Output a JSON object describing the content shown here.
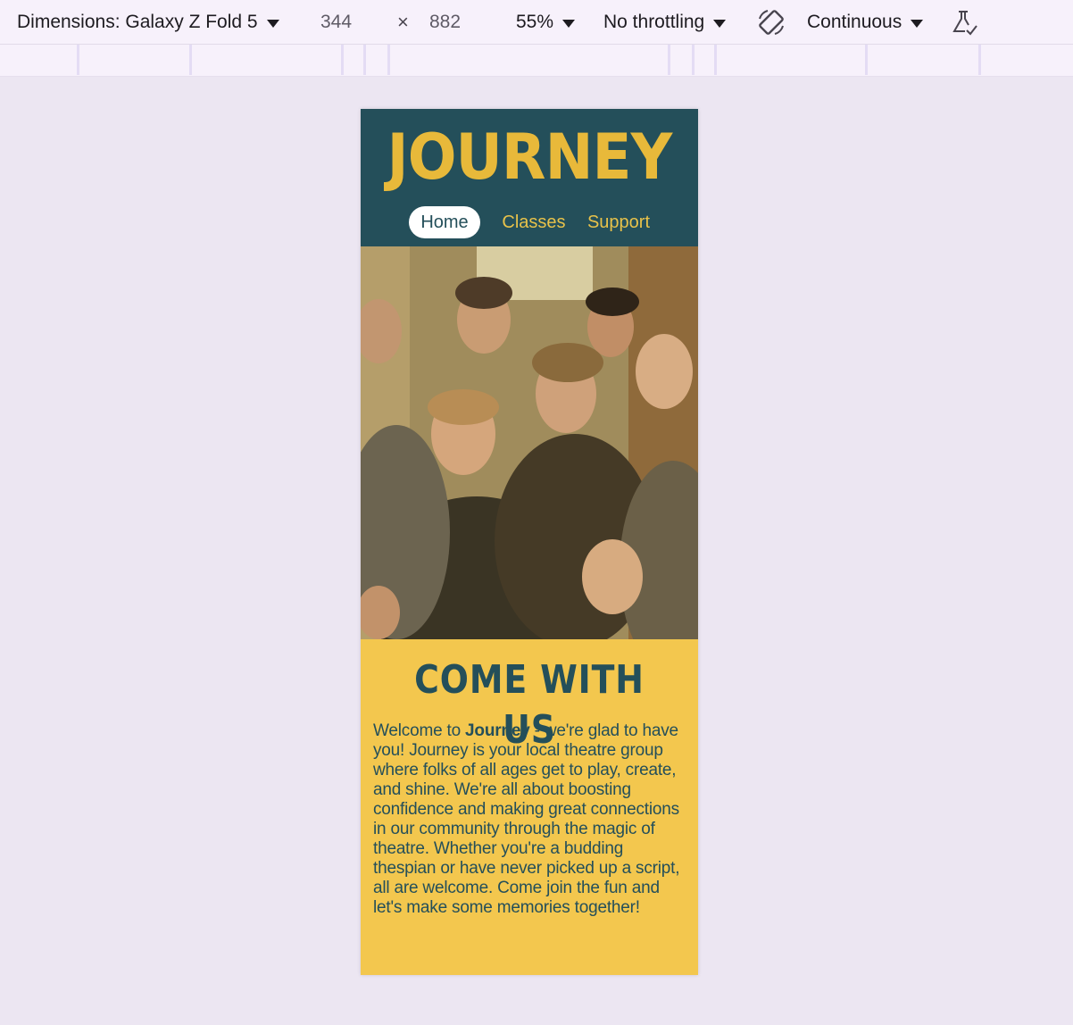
{
  "devtools": {
    "dimensions_label": "Dimensions: Galaxy Z Fold 5",
    "width": "344",
    "times": "×",
    "height": "882",
    "zoom": "55%",
    "throttling": "No throttling",
    "rotate_icon": "rotate-icon",
    "mode": "Continuous",
    "flask_icon": "flask-icon"
  },
  "site": {
    "logo": "JOURNEY",
    "nav": [
      {
        "label": "Home",
        "active": true
      },
      {
        "label": "Classes",
        "active": false
      },
      {
        "label": "Support",
        "active": false
      }
    ],
    "headline": "COME WITH US",
    "intro_prefix": "Welcome to ",
    "intro_bold": "Journey",
    "intro_rest": " - we're glad to have you! Journey is your local theatre group where folks of all ages get to play, create, and shine. We're all about boosting confidence and making great connections in our community through the magic of theatre. Whether you're a budding thespian or have never picked up a script, all are welcome. Come join the fun and let's make some memories together!"
  },
  "colors": {
    "header_bg": "#244f5a",
    "accent_yellow": "#f3c74e",
    "logo_yellow": "#e8b93a",
    "page_bg": "#ece6f2"
  }
}
